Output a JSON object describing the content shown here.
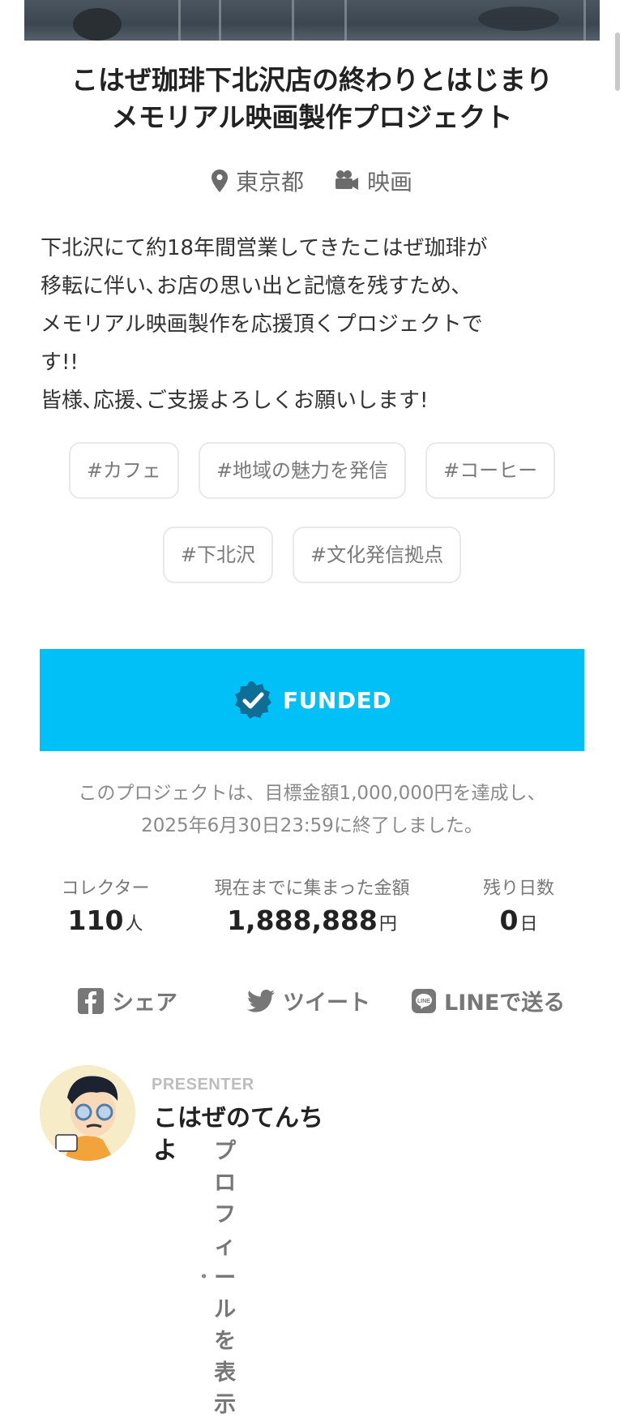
{
  "project": {
    "title_line1": "こはぜ珈琲下北沢店の終わりとはじまり",
    "title_line2": "メモリアル映画製作プロジェクト",
    "location": "東京都",
    "category": "映画",
    "description": "下北沢にて約18年間営業してきたこはぜ珈琲が\n移転に伴い､お店の思い出と記憶を残すため､\nメモリアル映画製作を応援頂くプロジェクトで\nす!!\n皆様､応援､ご支援よろしくお願いします!",
    "tags": [
      "#カフェ",
      "#地域の魅力を発信",
      "#コーヒー",
      "#下北沢",
      "#文化発信拠点"
    ]
  },
  "status": {
    "badge": "FUNDED",
    "note_line1": "このプロジェクトは、目標金額1,000,000円を達成し、",
    "note_line2": "2025年6月30日23:59に終了しました。"
  },
  "stats": {
    "collectors_label": "コレクター",
    "collectors_value": "110",
    "collectors_unit": "人",
    "amount_label": "現在までに集まった金額",
    "amount_value": "1,888,888",
    "amount_unit": "円",
    "days_label": "残り日数",
    "days_value": "0",
    "days_unit": "日"
  },
  "share": {
    "facebook": "シェア",
    "twitter": "ツイート",
    "line": "LINEで送る"
  },
  "presenter": {
    "label": "PRESENTER",
    "name_line1": "こはぜのてんち",
    "name_line2": "よ",
    "profile_link": "プロフィールを表示"
  },
  "colors": {
    "funded_bg": "#00c1f7",
    "badge_icon": "#0f6e96"
  }
}
